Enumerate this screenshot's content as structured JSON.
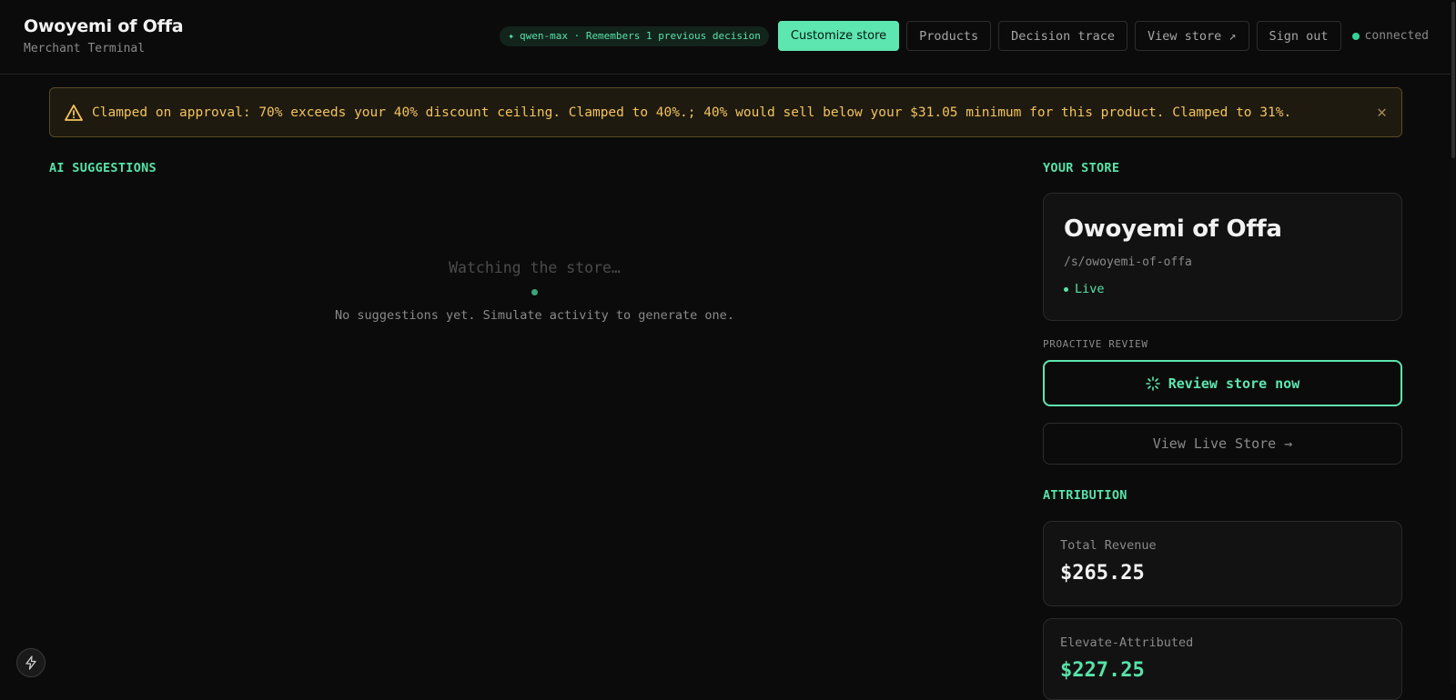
{
  "brand": {
    "title": "Owoyemi of Offa",
    "subtitle": "Merchant Terminal"
  },
  "nav": {
    "model_pill": "qwen-max · Remembers 1 previous decision",
    "customize": "Customize store",
    "products": "Products",
    "decision_trace": "Decision trace",
    "view_store": "View store ↗",
    "sign_out": "Sign out",
    "status": "connected"
  },
  "alert": {
    "text": "Clamped on approval: 70% exceeds your 40% discount ceiling. Clamped to 40%.; 40% would sell below your $31.05 minimum for this product. Clamped to 31%."
  },
  "suggestions": {
    "title": "AI SUGGESTIONS",
    "watching": "Watching the store…",
    "empty_message": "No suggestions yet. Simulate activity to generate one."
  },
  "store": {
    "section_title": "YOUR STORE",
    "name": "Owoyemi of Offa",
    "slug": "/s/owoyemi-of-offa",
    "status": "Live"
  },
  "review": {
    "label": "PROACTIVE REVIEW",
    "button": "Review store now",
    "live_store_button": "View Live Store →"
  },
  "attribution": {
    "title": "ATTRIBUTION",
    "total_revenue_label": "Total Revenue",
    "total_revenue_value": "$265.25",
    "attributed_label": "Elevate-Attributed",
    "attributed_value": "$227.25"
  },
  "colors": {
    "accent": "#5ee6b0",
    "background": "#0b0b0b",
    "warning": "#f3c35c"
  },
  "icons": {
    "model": "sparkle-icon",
    "alert": "warning-icon",
    "close": "close-icon",
    "review": "spinner-icon",
    "fab": "lightning-icon"
  }
}
